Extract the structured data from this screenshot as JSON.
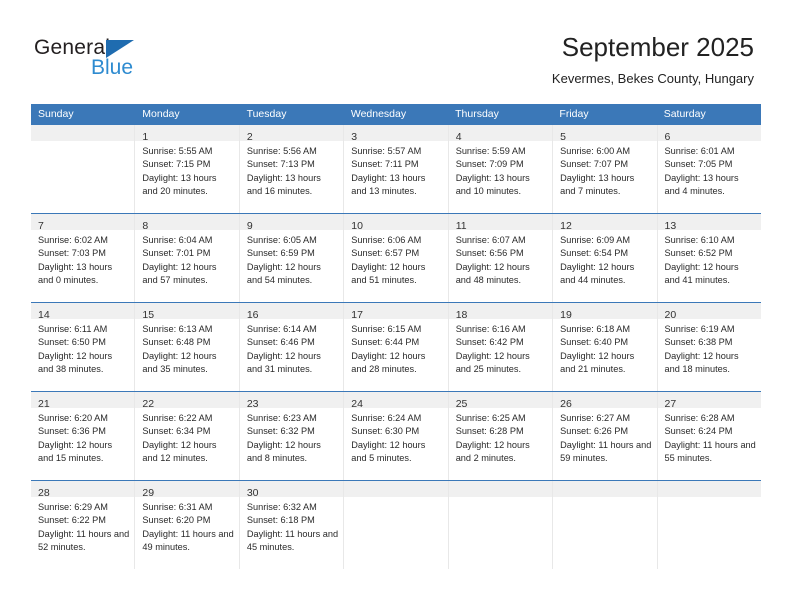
{
  "brand": {
    "name_dark": "General",
    "name_blue": "Blue",
    "accent_color": "#2e8bd0",
    "triangle_color": "#1f6cb0"
  },
  "header": {
    "title": "September 2025",
    "location": "Kevermes, Bekes County, Hungary",
    "header_bg": "#3b78b8",
    "daynum_bg": "#f0f0f0"
  },
  "weekdays": [
    "Sunday",
    "Monday",
    "Tuesday",
    "Wednesday",
    "Thursday",
    "Friday",
    "Saturday"
  ],
  "weeks": [
    [
      {
        "day": "",
        "sunrise": "",
        "sunset": "",
        "daylight": "",
        "empty": true
      },
      {
        "day": "1",
        "sunrise": "Sunrise: 5:55 AM",
        "sunset": "Sunset: 7:15 PM",
        "daylight": "Daylight: 13 hours and 20 minutes."
      },
      {
        "day": "2",
        "sunrise": "Sunrise: 5:56 AM",
        "sunset": "Sunset: 7:13 PM",
        "daylight": "Daylight: 13 hours and 16 minutes."
      },
      {
        "day": "3",
        "sunrise": "Sunrise: 5:57 AM",
        "sunset": "Sunset: 7:11 PM",
        "daylight": "Daylight: 13 hours and 13 minutes."
      },
      {
        "day": "4",
        "sunrise": "Sunrise: 5:59 AM",
        "sunset": "Sunset: 7:09 PM",
        "daylight": "Daylight: 13 hours and 10 minutes."
      },
      {
        "day": "5",
        "sunrise": "Sunrise: 6:00 AM",
        "sunset": "Sunset: 7:07 PM",
        "daylight": "Daylight: 13 hours and 7 minutes."
      },
      {
        "day": "6",
        "sunrise": "Sunrise: 6:01 AM",
        "sunset": "Sunset: 7:05 PM",
        "daylight": "Daylight: 13 hours and 4 minutes."
      }
    ],
    [
      {
        "day": "7",
        "sunrise": "Sunrise: 6:02 AM",
        "sunset": "Sunset: 7:03 PM",
        "daylight": "Daylight: 13 hours and 0 minutes."
      },
      {
        "day": "8",
        "sunrise": "Sunrise: 6:04 AM",
        "sunset": "Sunset: 7:01 PM",
        "daylight": "Daylight: 12 hours and 57 minutes."
      },
      {
        "day": "9",
        "sunrise": "Sunrise: 6:05 AM",
        "sunset": "Sunset: 6:59 PM",
        "daylight": "Daylight: 12 hours and 54 minutes."
      },
      {
        "day": "10",
        "sunrise": "Sunrise: 6:06 AM",
        "sunset": "Sunset: 6:57 PM",
        "daylight": "Daylight: 12 hours and 51 minutes."
      },
      {
        "day": "11",
        "sunrise": "Sunrise: 6:07 AM",
        "sunset": "Sunset: 6:56 PM",
        "daylight": "Daylight: 12 hours and 48 minutes."
      },
      {
        "day": "12",
        "sunrise": "Sunrise: 6:09 AM",
        "sunset": "Sunset: 6:54 PM",
        "daylight": "Daylight: 12 hours and 44 minutes."
      },
      {
        "day": "13",
        "sunrise": "Sunrise: 6:10 AM",
        "sunset": "Sunset: 6:52 PM",
        "daylight": "Daylight: 12 hours and 41 minutes."
      }
    ],
    [
      {
        "day": "14",
        "sunrise": "Sunrise: 6:11 AM",
        "sunset": "Sunset: 6:50 PM",
        "daylight": "Daylight: 12 hours and 38 minutes."
      },
      {
        "day": "15",
        "sunrise": "Sunrise: 6:13 AM",
        "sunset": "Sunset: 6:48 PM",
        "daylight": "Daylight: 12 hours and 35 minutes."
      },
      {
        "day": "16",
        "sunrise": "Sunrise: 6:14 AM",
        "sunset": "Sunset: 6:46 PM",
        "daylight": "Daylight: 12 hours and 31 minutes."
      },
      {
        "day": "17",
        "sunrise": "Sunrise: 6:15 AM",
        "sunset": "Sunset: 6:44 PM",
        "daylight": "Daylight: 12 hours and 28 minutes."
      },
      {
        "day": "18",
        "sunrise": "Sunrise: 6:16 AM",
        "sunset": "Sunset: 6:42 PM",
        "daylight": "Daylight: 12 hours and 25 minutes."
      },
      {
        "day": "19",
        "sunrise": "Sunrise: 6:18 AM",
        "sunset": "Sunset: 6:40 PM",
        "daylight": "Daylight: 12 hours and 21 minutes."
      },
      {
        "day": "20",
        "sunrise": "Sunrise: 6:19 AM",
        "sunset": "Sunset: 6:38 PM",
        "daylight": "Daylight: 12 hours and 18 minutes."
      }
    ],
    [
      {
        "day": "21",
        "sunrise": "Sunrise: 6:20 AM",
        "sunset": "Sunset: 6:36 PM",
        "daylight": "Daylight: 12 hours and 15 minutes."
      },
      {
        "day": "22",
        "sunrise": "Sunrise: 6:22 AM",
        "sunset": "Sunset: 6:34 PM",
        "daylight": "Daylight: 12 hours and 12 minutes."
      },
      {
        "day": "23",
        "sunrise": "Sunrise: 6:23 AM",
        "sunset": "Sunset: 6:32 PM",
        "daylight": "Daylight: 12 hours and 8 minutes."
      },
      {
        "day": "24",
        "sunrise": "Sunrise: 6:24 AM",
        "sunset": "Sunset: 6:30 PM",
        "daylight": "Daylight: 12 hours and 5 minutes."
      },
      {
        "day": "25",
        "sunrise": "Sunrise: 6:25 AM",
        "sunset": "Sunset: 6:28 PM",
        "daylight": "Daylight: 12 hours and 2 minutes."
      },
      {
        "day": "26",
        "sunrise": "Sunrise: 6:27 AM",
        "sunset": "Sunset: 6:26 PM",
        "daylight": "Daylight: 11 hours and 59 minutes."
      },
      {
        "day": "27",
        "sunrise": "Sunrise: 6:28 AM",
        "sunset": "Sunset: 6:24 PM",
        "daylight": "Daylight: 11 hours and 55 minutes."
      }
    ],
    [
      {
        "day": "28",
        "sunrise": "Sunrise: 6:29 AM",
        "sunset": "Sunset: 6:22 PM",
        "daylight": "Daylight: 11 hours and 52 minutes."
      },
      {
        "day": "29",
        "sunrise": "Sunrise: 6:31 AM",
        "sunset": "Sunset: 6:20 PM",
        "daylight": "Daylight: 11 hours and 49 minutes."
      },
      {
        "day": "30",
        "sunrise": "Sunrise: 6:32 AM",
        "sunset": "Sunset: 6:18 PM",
        "daylight": "Daylight: 11 hours and 45 minutes."
      },
      {
        "day": "",
        "sunrise": "",
        "sunset": "",
        "daylight": "",
        "empty": true
      },
      {
        "day": "",
        "sunrise": "",
        "sunset": "",
        "daylight": "",
        "empty": true
      },
      {
        "day": "",
        "sunrise": "",
        "sunset": "",
        "daylight": "",
        "empty": true
      },
      {
        "day": "",
        "sunrise": "",
        "sunset": "",
        "daylight": "",
        "empty": true
      }
    ]
  ]
}
